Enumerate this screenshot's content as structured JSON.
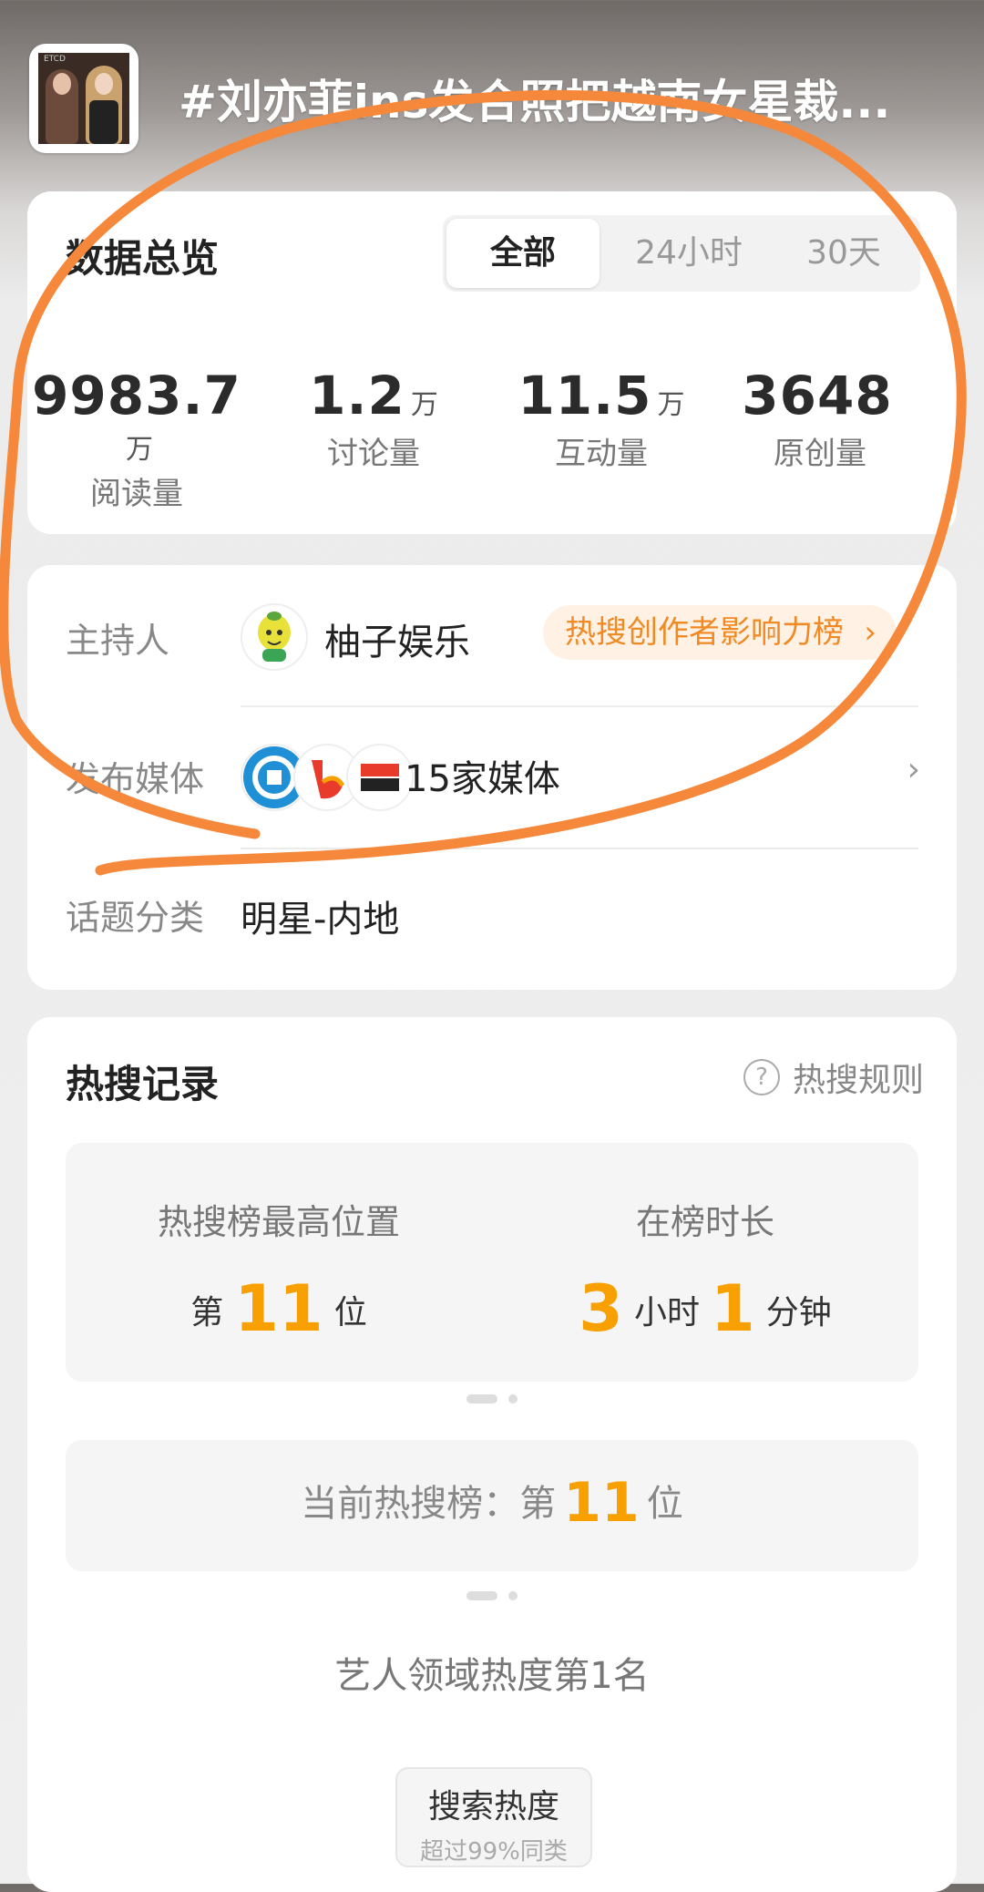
{
  "header": {
    "title": "#刘亦菲ins发合照把越南女星裁...",
    "thumb_tag": "ETCD"
  },
  "overview": {
    "title": "数据总览",
    "tabs": [
      {
        "label": "全部",
        "active": true
      },
      {
        "label": "24小时",
        "active": false
      },
      {
        "label": "30天",
        "active": false
      }
    ],
    "stats": [
      {
        "value": "9983.7",
        "unit": "万",
        "label": "阅读量"
      },
      {
        "value": "1.2",
        "unit": "万",
        "label": "讨论量"
      },
      {
        "value": "11.5",
        "unit": "万",
        "label": "互动量"
      },
      {
        "value": "3648",
        "unit": "",
        "label": "原创量"
      }
    ]
  },
  "info": {
    "host_label": "主持人",
    "host_name": "柚子娱乐",
    "host_badge": "热搜创作者影响力榜",
    "media_label": "发布媒体",
    "media_count": "15家媒体",
    "topic_label": "话题分类",
    "topic_value": "明星-内地"
  },
  "hot": {
    "title": "热搜记录",
    "rules_label": "热搜规则",
    "peak_label": "热搜榜最高位置",
    "peak_prefix": "第",
    "peak_value": "11",
    "peak_suffix": "位",
    "duration_label": "在榜时长",
    "duration_hours": "3",
    "duration_hours_unit": "小时",
    "duration_minutes": "1",
    "duration_minutes_unit": "分钟",
    "current_label": "当前热搜榜：第",
    "current_value": "11",
    "current_suffix": "位",
    "domain_rank": "艺人领域热度第1名",
    "chip_title": "搜索热度",
    "chip_sub": "超过99%同类"
  },
  "colors": {
    "accent": "#f7a000",
    "badge_text": "#f08a24",
    "annotation": "#f5883a"
  }
}
